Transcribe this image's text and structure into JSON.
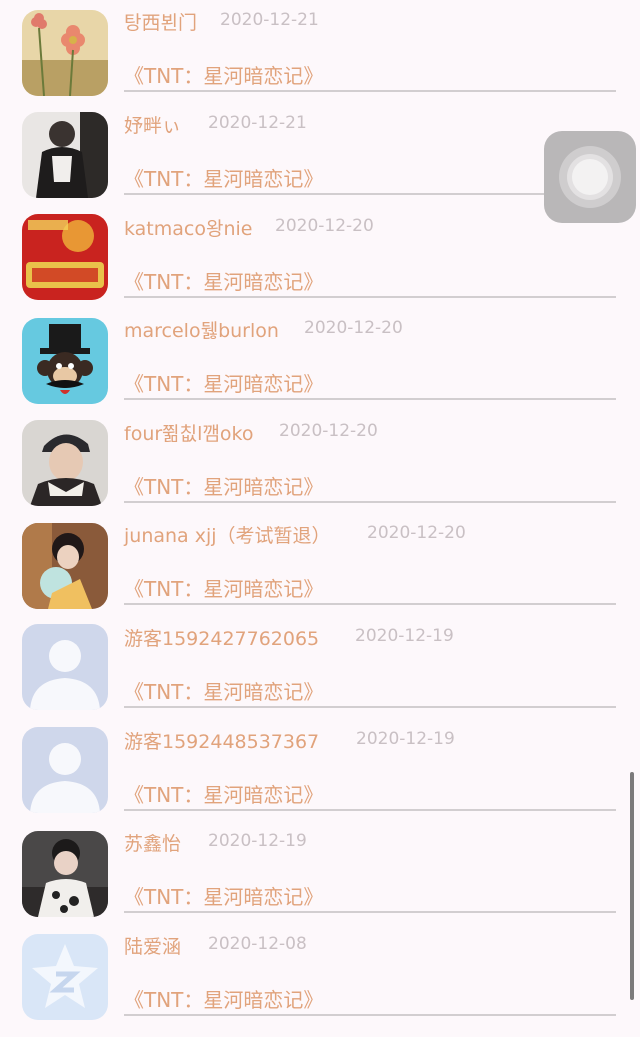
{
  "comments": [
    {
      "avatar": "cosmos-flower-avatar",
      "username": "탕西뵌门",
      "date": "2020-12-21",
      "book": "《TNT：星河暗恋记》"
    },
    {
      "avatar": "person-avatar",
      "username": "妤畔ぃ",
      "date": "2020-12-21",
      "book": "《TNT：星河暗恋记》"
    },
    {
      "avatar": "new-year-avatar",
      "username": "katmaco왕nie",
      "date": "2020-12-20",
      "book": "《TNT：星河暗恋记》"
    },
    {
      "avatar": "monkey-hat-avatar",
      "username": "marcelo뒗burlon",
      "date": "2020-12-20",
      "book": "《TNT：星河暗恋记》"
    },
    {
      "avatar": "person-cap-avatar",
      "username": "four쮦칪l깸oko",
      "date": "2020-12-20",
      "book": "《TNT：星河暗恋记》"
    },
    {
      "avatar": "girl-fan-avatar",
      "username": "junana xjj（考试暂退）",
      "date": "2020-12-20",
      "book": "《TNT：星河暗恋记》"
    },
    {
      "avatar": "default-user-avatar",
      "username": "游客1592427762065",
      "date": "2020-12-19",
      "book": "《TNT：星河暗恋记》"
    },
    {
      "avatar": "default-user-avatar",
      "username": "游客1592448537367",
      "date": "2020-12-19",
      "book": "《TNT：星河暗恋记》"
    },
    {
      "avatar": "selfie-avatar",
      "username": "苏鑫怡",
      "date": "2020-12-19",
      "book": "《TNT：星河暗恋记》"
    },
    {
      "avatar": "qq-logo-avatar",
      "username": "陆爱涵",
      "date": "2020-12-08",
      "book": "《TNT：星河暗恋记》"
    }
  ],
  "colors": {
    "background": "#fdf8fb",
    "accent_text": "#e1a37c",
    "date_text": "#c9c0c4",
    "divider": "#d2ced0"
  }
}
